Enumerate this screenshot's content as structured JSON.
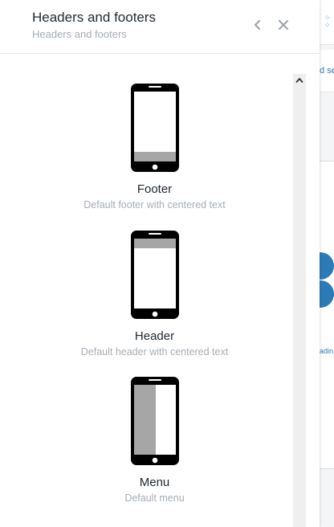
{
  "panel": {
    "title": "Headers and footers",
    "subtitle": "Headers and footers",
    "back_icon": "chevron-left-icon",
    "close_icon": "close-icon"
  },
  "items": [
    {
      "label": "Footer",
      "description": "Default footer with centered text",
      "icon": "phone-footer-icon"
    },
    {
      "label": "Header",
      "description": "Default header with centered text",
      "icon": "phone-header-icon"
    },
    {
      "label": "Menu",
      "description": "Default menu",
      "icon": "phone-menu-icon"
    }
  ],
  "background": {
    "band_text": "d se",
    "card_text": "adin",
    "accent": "#2b7bb9"
  },
  "colors": {
    "title": "#222a33",
    "muted": "#a7adb4",
    "phone": "#000000",
    "phone_fill": "#a6a6a6"
  }
}
